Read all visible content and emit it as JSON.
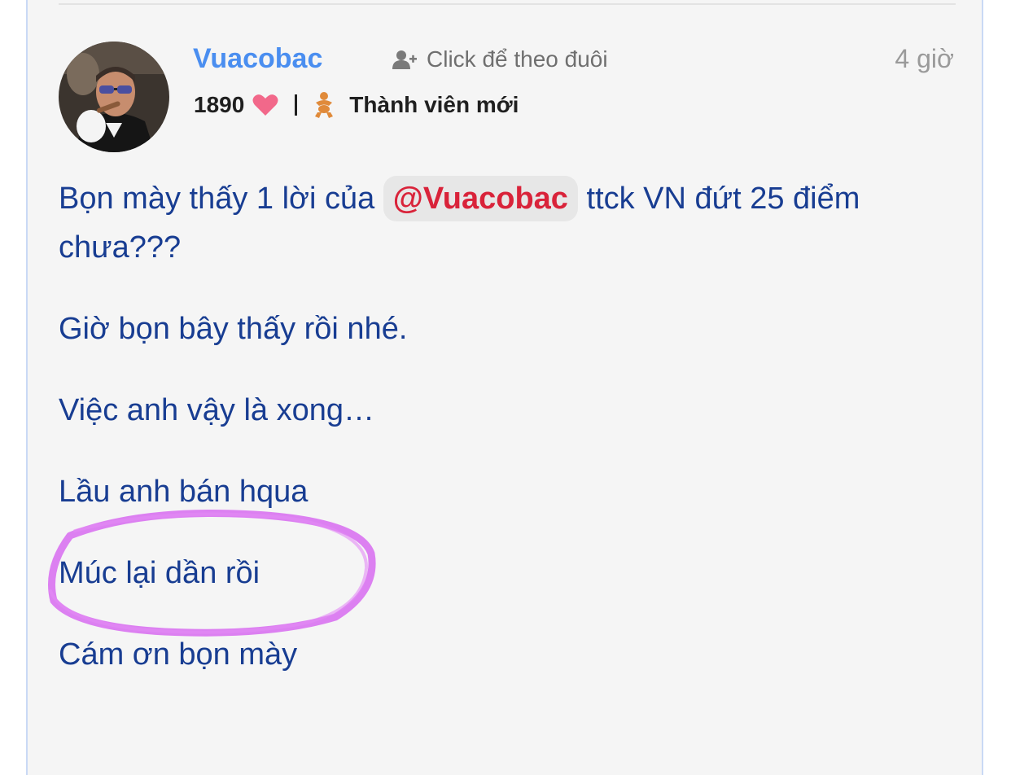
{
  "post": {
    "author": {
      "name": "Vuacobac",
      "points": "1890",
      "rank": "Thành viên mới"
    },
    "follow_label": "Click để theo đuôi",
    "time": "4 giờ",
    "content": {
      "line1_before": "Bọn mày thấy 1 lời của ",
      "mention": "@Vuacobac",
      "line1_after": " ttck VN đứt 25 điểm chưa???",
      "para2": "Giờ bọn bây thấy rồi nhé.",
      "para3": "Việc anh vậy là xong…",
      "para4": "Lầu anh bán hqua",
      "para5": "Múc lại dần rồi",
      "para6": "Cám ơn bọn mày"
    }
  },
  "colors": {
    "username": "#4a8ef0",
    "mention": "#d9233a",
    "body_text": "#183d92",
    "heart": "#f2688a",
    "highlight": "#d76bf0"
  },
  "icons": {
    "follow": "user-plus-icon",
    "points": "heart-icon",
    "rank": "baby-rank-icon"
  }
}
